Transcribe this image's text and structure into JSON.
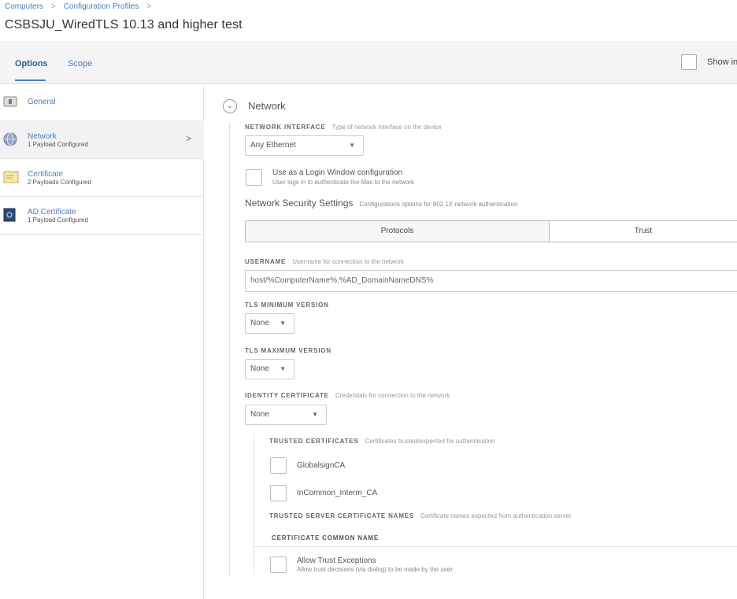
{
  "breadcrumb": {
    "items": [
      "Computers",
      "Configuration Profiles"
    ],
    "separator": ">"
  },
  "page": {
    "title": "CSBSJU_WiredTLS 10.13 and higher test"
  },
  "tabs": [
    {
      "label": "Options",
      "active": true
    },
    {
      "label": "Scope",
      "active": false
    }
  ],
  "show_in": {
    "label": "Show in"
  },
  "sidebar": {
    "items": [
      {
        "name": "General",
        "subtitle": "",
        "icon": "general-icon"
      },
      {
        "name": "Network",
        "subtitle": "1 Payload Configured",
        "icon": "network-globe-icon",
        "chevron": ">"
      },
      {
        "name": "Certificate",
        "subtitle": "2 Payloads Configured",
        "icon": "certificate-icon"
      },
      {
        "name": "AD Certificate",
        "subtitle": "1 Payload Configured",
        "icon": "ad-certificate-icon"
      }
    ]
  },
  "network": {
    "collapse_glyph": "⌄",
    "heading": "Network",
    "interface": {
      "label": "NETWORK INTERFACE",
      "hint": "Type of network interface on the device",
      "value": "Any Ethernet"
    },
    "login_window": {
      "label": "Use as a Login Window configuration",
      "sub": "User logs in to authenticate the Mac to the network"
    },
    "security": {
      "heading": "Network Security Settings",
      "hint": "Configurations options for 802.1X network authentication",
      "segments": [
        "Protocols",
        "Trust"
      ]
    },
    "username": {
      "label": "USERNAME",
      "hint": "Username for connection to the network",
      "value": "host/%ComputerName%.%AD_DomainNameDNS%"
    },
    "tls_min": {
      "label": "TLS MINIMUM VERSION",
      "value": "None"
    },
    "tls_max": {
      "label": "TLS MAXIMUM VERSION",
      "value": "None"
    },
    "identity": {
      "label": "IDENTITY CERTIFICATE",
      "hint": "Credentials for connection to the network",
      "value": "None"
    },
    "trusted": {
      "label": "TRUSTED CERTIFICATES",
      "hint": "Certificates trusted/expected for authentication",
      "items": [
        "GlobalsignCA",
        "InCommon_Interm_CA"
      ]
    },
    "server_names": {
      "label": "TRUSTED SERVER CERTIFICATE NAMES",
      "hint": "Certificate names expected from authentication server",
      "column": "CERTIFICATE COMMON NAME"
    },
    "trust_exceptions": {
      "label": "Allow Trust Exceptions",
      "sub": "Allow trust decisions (via dialog) to be made by the user"
    }
  },
  "glyphs": {
    "caret": "▼"
  },
  "colors": {
    "link": "#4a7dbd",
    "active_bg": "#f2f2f4"
  }
}
